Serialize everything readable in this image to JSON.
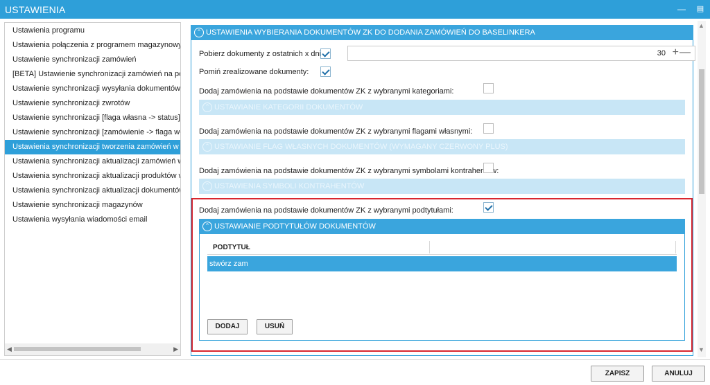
{
  "window": {
    "title": "USTAWIENIA"
  },
  "sidebar": {
    "items": [
      {
        "label": "Ustawienia programu",
        "active": false
      },
      {
        "label": "Ustawienia połączenia z programem magazynowym",
        "active": false
      },
      {
        "label": "Ustawienie synchronizacji zamówień",
        "active": false
      },
      {
        "label": "[BETA] Ustawienie synchronizacji zamówień na podsta",
        "active": false
      },
      {
        "label": "Ustawienie synchronizacji wysyłania dokumentów",
        "active": false
      },
      {
        "label": "Ustawienie synchronizacji zwrotów",
        "active": false
      },
      {
        "label": "Ustawienie synchronizacji [flaga własna -> status]",
        "active": false
      },
      {
        "label": "Ustawienie synchronizacji [zamówienie -> flaga własn",
        "active": false
      },
      {
        "label": "Ustawienia synchronizacji tworzenia zamówień w Base",
        "active": true
      },
      {
        "label": "Ustawienia synchronizacji aktualizacji zamówień w Bas",
        "active": false
      },
      {
        "label": "Ustawienia synchronizacji aktualizacji produktów w Ba",
        "active": false
      },
      {
        "label": "Ustawienia synchronizacji aktualizacji dokumentów",
        "active": false
      },
      {
        "label": "Ustawienie synchronizacji magazynów",
        "active": false
      },
      {
        "label": "Ustawienia wysyłania wiadomości email",
        "active": false
      }
    ]
  },
  "main": {
    "section_title": "USTAWIENIA WYBIERANIA DOKUMENTÓW ZK DO DODANIA ZAMÓWIEŃ DO BASELINKERA",
    "fetch_days": {
      "label": "Pobierz dokumenty z ostatnich x dni:",
      "checked": true,
      "value": "30"
    },
    "skip_realized": {
      "label": "Pomiń zrealizowane dokumenty:",
      "checked": true
    },
    "by_categories": {
      "label": "Dodaj zamówienia na podstawie dokumentów ZK z wybranymi kategoriami:",
      "checked": false,
      "subsection": "USTAWIANIE KATEGORII DOKUMENTÓW"
    },
    "by_flags": {
      "label": "Dodaj zamówienia na podstawie dokumentów ZK z wybranymi flagami własnymi:",
      "checked": false,
      "subsection": "USTAWIANIE FLAG WŁASNYCH DOKUMENTÓW (WYMAGANY CZERWONY PLUS)"
    },
    "by_symbols": {
      "label": "Dodaj zamówienia na podstawie dokumentów ZK z wybranymi symbolami kontrahentów:",
      "checked": false,
      "subsection": "USTAWIENIA SYMBOLI KONTRAHENTÓW"
    },
    "by_subtitles": {
      "label": "Dodaj zamówienia na podstawie dokumentów ZK z wybranymi podtytułami:",
      "checked": true,
      "subsection": "USTAWIANIE PODTYTUŁÓW DOKUMENTÓW",
      "grid": {
        "column": "PODTYTUŁ",
        "rows": [
          "stwórz zam"
        ]
      },
      "add_label": "DODAJ",
      "remove_label": "USUŃ"
    }
  },
  "footer": {
    "save_label": "ZAPISZ",
    "cancel_label": "ANULUJ"
  },
  "colors": {
    "accent": "#2e9fd9",
    "highlight_border": "#d9262e",
    "disabled_header": "#c8e6f6"
  }
}
